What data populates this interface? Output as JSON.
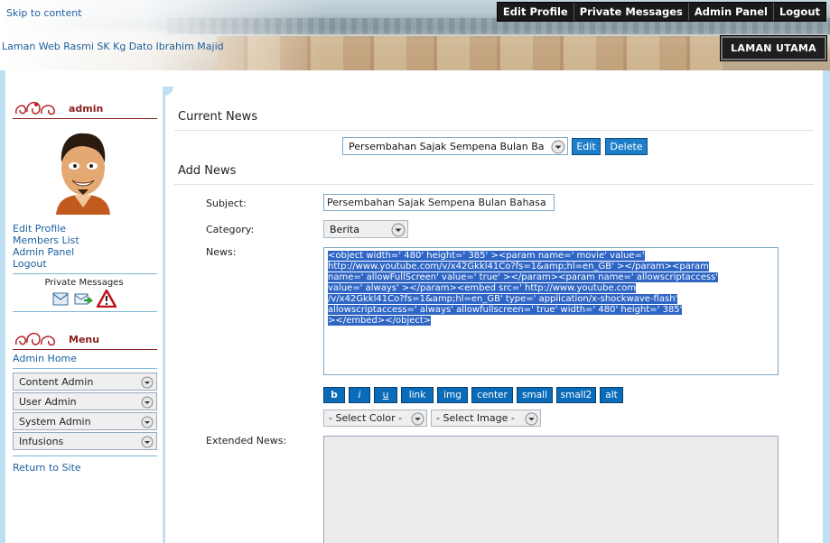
{
  "header": {
    "skip_link": "Skip to content",
    "site_title": "Laman Web Rasmi SK Kg Dato Ibrahim Majid",
    "topnav": [
      "Edit Profile",
      "Private Messages",
      "Admin Panel",
      "Logout"
    ],
    "home_button": "LAMAN UTAMA"
  },
  "sidebar": {
    "user_title": "admin",
    "links": [
      "Edit Profile",
      "Members List",
      "Admin Panel",
      "Logout"
    ],
    "pm_label": "Private Messages",
    "pm_icons": [
      "inbox-icon",
      "send-icon",
      "warning-icon"
    ],
    "menu_title": "Menu",
    "admin_home": "Admin Home",
    "menu_items": [
      "Content Admin",
      "User Admin",
      "System Admin",
      "Infusions"
    ],
    "return_link": "Return to Site"
  },
  "main": {
    "current_news_title": "Current News",
    "current_news_value": "Persembahan Sajak Sempena Bulan Ba",
    "edit_button": "Edit",
    "delete_button": "Delete",
    "add_news_title": "Add News",
    "subject_label": "Subject:",
    "subject_value": "Persembahan Sajak Sempena Bulan Bahasa",
    "category_label": "Category:",
    "category_value": "Berita",
    "news_label": "News:",
    "news_lines": [
      "<object width=' 480'  height=' 385' ><param name=' movie'  value='",
      "http://www.youtube.com/v/x42Gkkl41Co?fs=1&amp;hl=en_GB' ></param><param",
      "name=' allowFullScreen'  value=' true' ></param><param name=' allowscriptaccess'",
      "value=' always' ></param><embed src=' http://www.youtube.com",
      "/v/x42Gkkl41Co?fs=1&amp;hl=en_GB'  type=' application/x-shockwave-flash'",
      "allowscriptaccess=' always'  allowfullscreen=' true'  width=' 480'  height=' 385'",
      "></embed></object>"
    ],
    "format_buttons": [
      "b",
      "i",
      "u",
      "link",
      "img",
      "center",
      "small",
      "small2",
      "alt"
    ],
    "select_color": "- Select Color -",
    "select_image": "- Select Image -",
    "extended_label": "Extended News:"
  },
  "colors": {
    "link": "#1a5f9e",
    "accent": "#8d1e1e",
    "button": "#1e7ec8",
    "selection": "#2f66c6"
  }
}
